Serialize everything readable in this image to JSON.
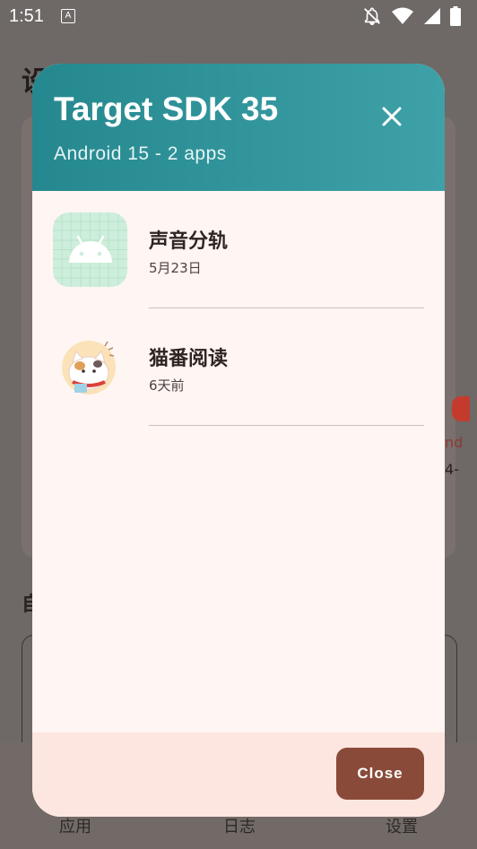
{
  "status_bar": {
    "time": "1:51",
    "notification_icon_letter": "A",
    "icons": [
      "notifications-off-icon",
      "wifi-icon",
      "signal-icon",
      "battery-icon"
    ]
  },
  "background": {
    "title": "设置",
    "section_label": "自",
    "side_text_1": "nd",
    "side_text_2": "4-",
    "nav_items": [
      "应用",
      "日志",
      "设置"
    ]
  },
  "dialog": {
    "title": "Target SDK 35",
    "subtitle": "Android 15  -  2 apps",
    "header_colors": [
      "#26888f",
      "#3ea1a8"
    ],
    "apps": [
      {
        "name": "声音分轨",
        "date": "5月23日",
        "icon": "android-default-icon"
      },
      {
        "name": "猫番阅读",
        "date": "6天前",
        "icon": "cat-reading-app-icon"
      }
    ],
    "close_button_label": "Close",
    "accent_color": "#8a4a3a"
  }
}
